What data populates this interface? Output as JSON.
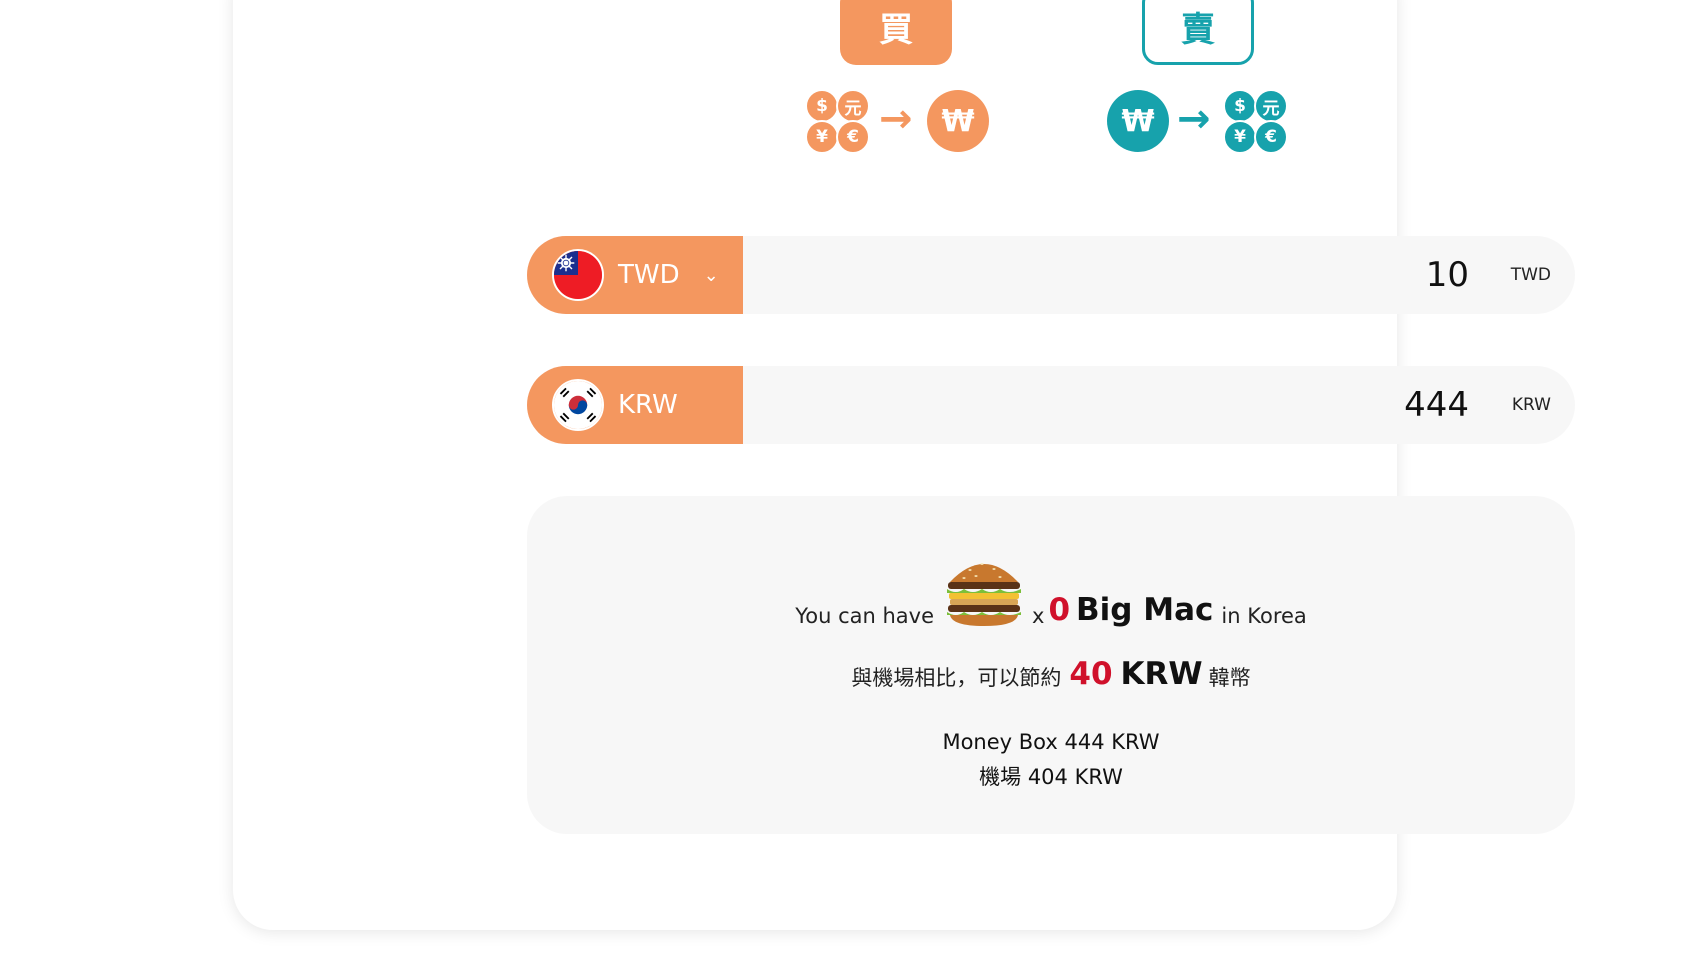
{
  "modes": {
    "buy": {
      "label": "買",
      "from_symbols": [
        "$",
        "元",
        "¥",
        "€"
      ],
      "to_symbol": "₩",
      "arrow": "→"
    },
    "sell": {
      "label": "賣",
      "from_symbol": "₩",
      "to_symbols": [
        "$",
        "元",
        "¥",
        "€"
      ],
      "arrow": "→"
    }
  },
  "from_currency": {
    "code": "TWD",
    "amount": "10",
    "unit": "TWD",
    "chevron": "⌄"
  },
  "to_currency": {
    "code": "KRW",
    "amount": "444",
    "unit": "KRW"
  },
  "result": {
    "prefix": "You can have",
    "times": "x",
    "bigmac_count": "0",
    "bigmac_label": "Big Mac",
    "suffix": "in Korea",
    "saving_prefix": "與機場相比，可以節約",
    "saving_value": "40",
    "saving_unit": "KRW",
    "saving_suffix": "韓幣",
    "moneybox_line": "Money Box 444 KRW",
    "airport_line": "機場 404 KRW"
  },
  "colors": {
    "orange": "#f4975f",
    "teal": "#17a2ac",
    "red": "#d0112b",
    "panel": "#f7f7f7"
  }
}
